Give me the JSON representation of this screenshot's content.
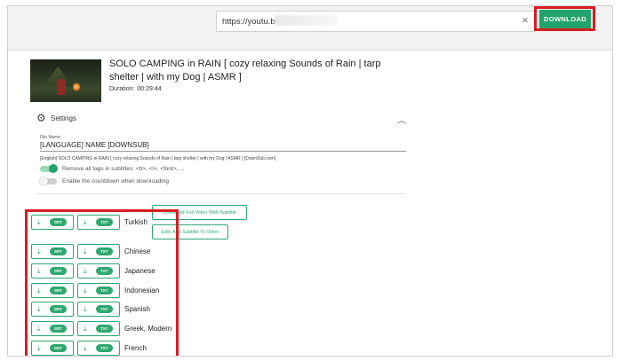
{
  "header": {
    "url_value": "https://youtu.be/BEF2vPF",
    "clear_symbol": "×",
    "download_label": "DOWNLOAD"
  },
  "video": {
    "title": "SOLO CAMPING in RAIN [ cozy relaxing Sounds of Rain | tarp shelter | with my Dog | ASMR ]",
    "duration_label": "Duration:",
    "duration_value": "00:29:44"
  },
  "settings": {
    "label": "Settings",
    "file_name_label": "File Name",
    "file_name_value": "[LANGUAGE] NAME [DOWNSUB]",
    "file_name_preview": "[English] SOLO CAMPING in RAIN [ cozy relaxing Sounds of Rain | tarp shelter | with my Dog | ASMR ] [DownSub.com]",
    "toggles": [
      {
        "label": "Remove all tags in subtitles: <b>, <i>, <font>, ...",
        "on": true
      },
      {
        "label": "Enable the countdown when downloading",
        "on": false
      }
    ]
  },
  "subtitles": {
    "srt_label": "SRT",
    "txt_label": "TXT",
    "languages": [
      "Turkish",
      "Chinese",
      "Japanese",
      "Indonesian",
      "Spanish",
      "Greek, Modern",
      "French"
    ]
  },
  "actions": {
    "full_video": "Download Full Video With Subtitle",
    "edit_add": "Edit, Add Subtitle To Video"
  },
  "colors": {
    "accent": "#22a36b",
    "highlight": "#d81e23"
  }
}
